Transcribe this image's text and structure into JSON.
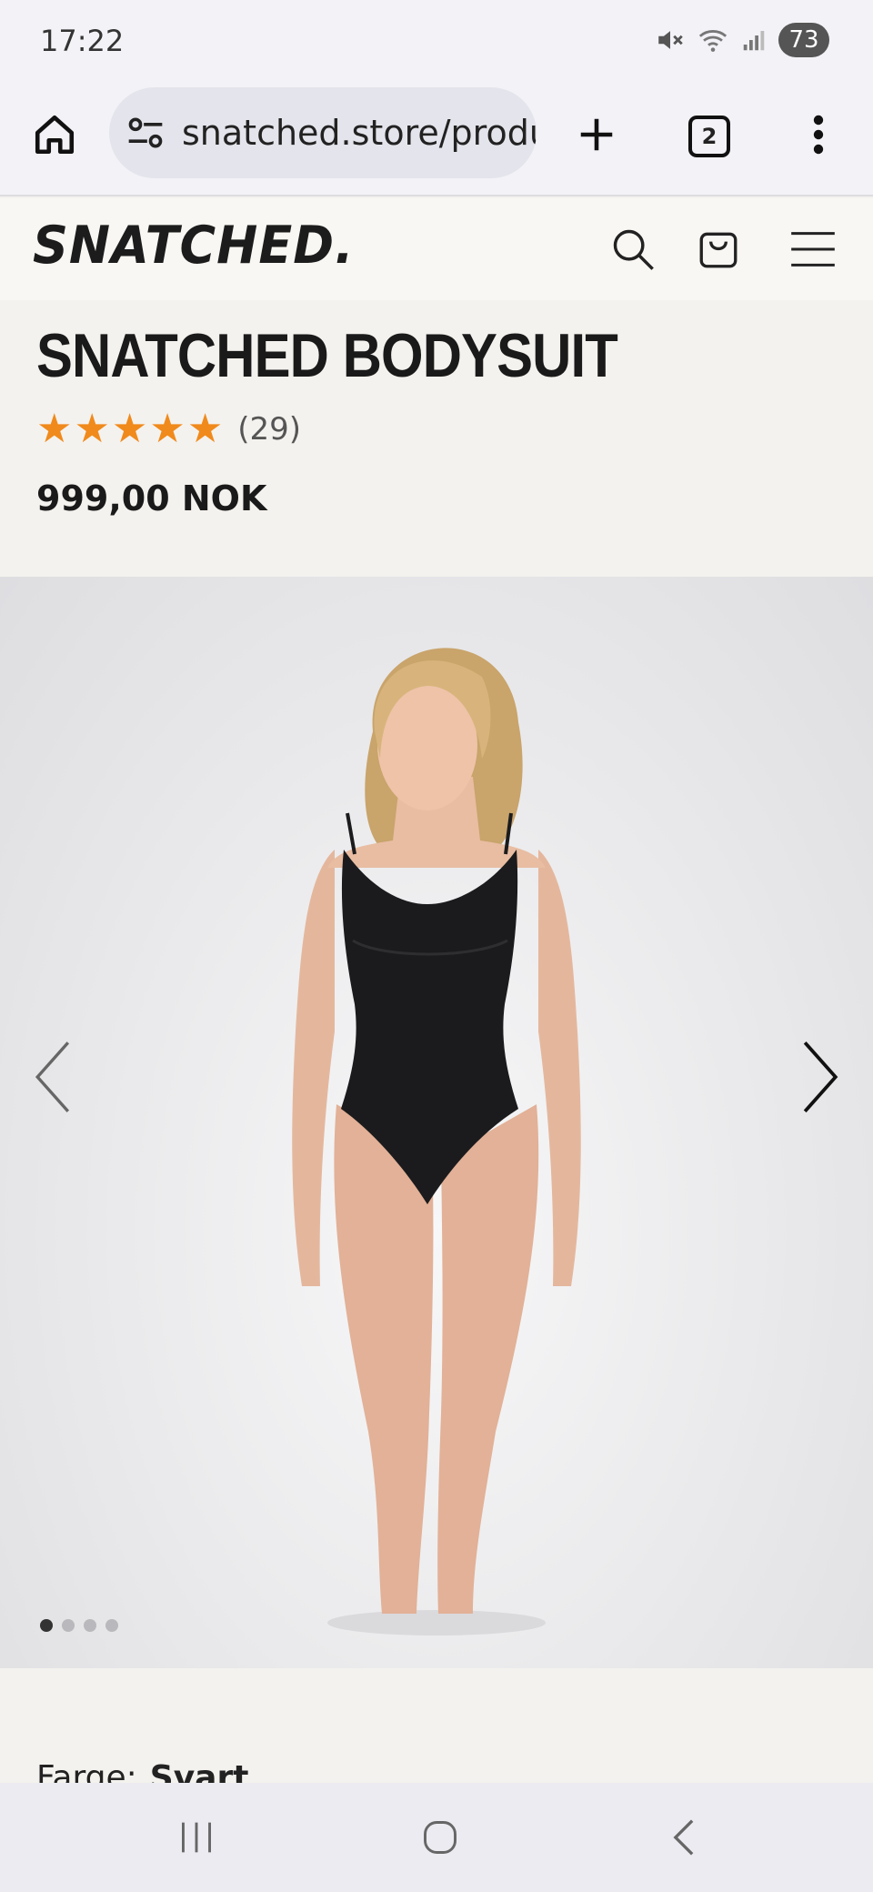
{
  "status_bar": {
    "time": "17:22",
    "battery": "73"
  },
  "browser": {
    "url": "snatched.store/produ",
    "tab_count": "2"
  },
  "site": {
    "logo": "SNATCHED."
  },
  "product": {
    "title": "SNATCHED BODYSUIT",
    "rating": 5,
    "review_count": "(29)",
    "price": "999,00 NOK",
    "star_color": "#f08a1c"
  },
  "gallery": {
    "image_count": 4,
    "active_index": 0
  },
  "variant": {
    "label": "Farge:",
    "value": "Svart"
  }
}
